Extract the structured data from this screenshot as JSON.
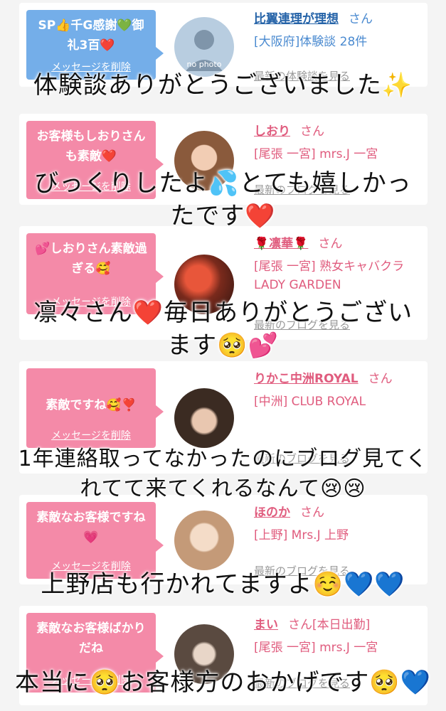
{
  "cards": [
    {
      "message": "SP👍千G感謝💚御礼3百❤️",
      "delete_label": "メッセージを削除",
      "name": "比翼連理が理想",
      "san": "さん",
      "shop": "[大阪府]体験談 28件",
      "blog": "最新の体験談を見る",
      "avatar_text": "no photo",
      "style": "blue"
    },
    {
      "message": "お客様もしおりさんも素敵❤️",
      "delete_label": "メッセージを削除",
      "name": "しおり",
      "san": "さん",
      "shop": "[尾張 一宮] mrs.J 一宮",
      "blog": "最新のブログを見る",
      "style": "pink"
    },
    {
      "message": "💕しおりさん素敵過ぎる🥰",
      "delete_label": "メッセージを削除",
      "name": "🌹凛華🌹",
      "san": "さん",
      "shop": "[尾張 一宮] 熟女キャバクラ LADY GARDEN",
      "blog": "最新のブログを見る",
      "style": "pink"
    },
    {
      "message": "素敵ですね🥰❣️",
      "delete_label": "メッセージを削除",
      "name": "りかこ中洲ROYAL",
      "san": "さん",
      "shop": "[中洲] CLUB ROYAL",
      "blog": "最新のブログを見る",
      "style": "pink"
    },
    {
      "message": "素敵なお客様ですね💗",
      "delete_label": "メッセージを削除",
      "name": "ほのか",
      "san": "さん",
      "shop": "[上野] Mrs.J 上野",
      "blog": "最新のブログを見る",
      "style": "pink"
    },
    {
      "message": "素敵なお客様ばかりだね",
      "delete_label": "メッセージを削除",
      "name": "まい",
      "san": "さん[本日出勤]",
      "shop": "[尾張 一宮] mrs.J 一宮",
      "blog": "最新のブログを見る",
      "style": "pink"
    }
  ],
  "overlays": [
    {
      "text": "体験談ありがとうございました✨"
    },
    {
      "text": "びっくりしたよ💦とても嬉しかっ"
    },
    {
      "text": "たです❤️"
    },
    {
      "text": "凛々さん❤️毎日ありがとうござい"
    },
    {
      "text": "ます🥺💕"
    },
    {
      "text": "1年連絡取ってなかったのにブログ見てく"
    },
    {
      "text": "れてて来てくれるなんて😢😢"
    },
    {
      "text": "上野店も行かれてますよ☺️💙💙"
    },
    {
      "text": "本当に🥺お客様方のおかげです🥺💙"
    }
  ],
  "colors": {
    "pink": "#f48aa8",
    "blue": "#74aee9",
    "name_pink": "#e05c7e",
    "name_blue": "#2563a8"
  }
}
